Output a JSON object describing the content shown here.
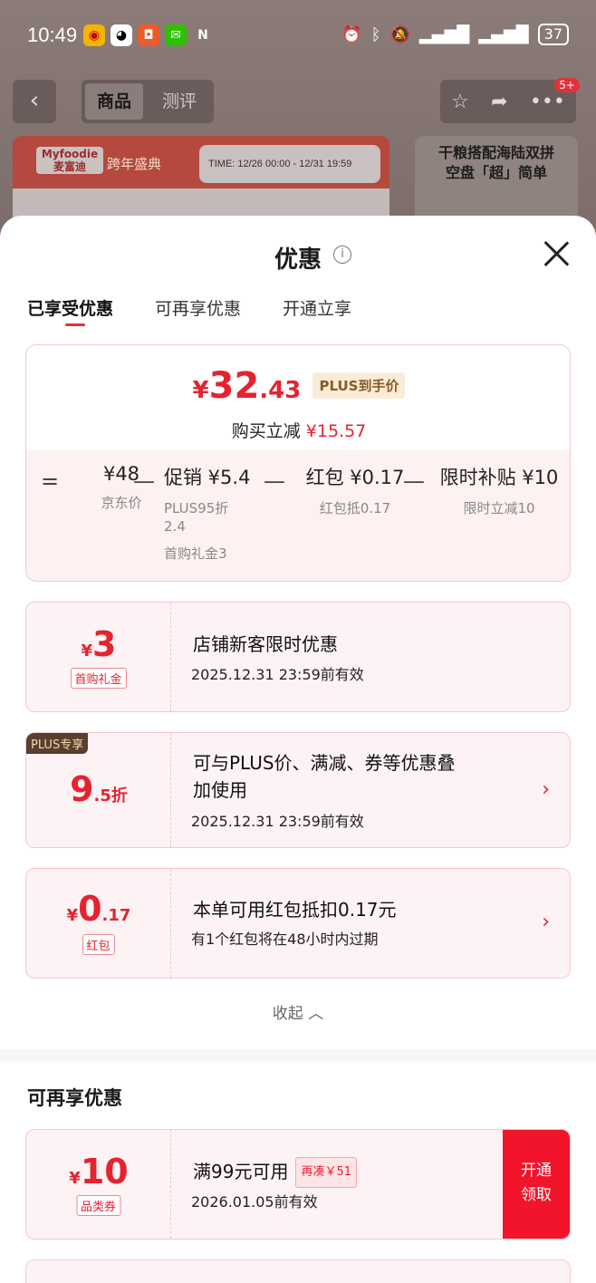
{
  "status_bar": {
    "time": "10:49",
    "battery": "37",
    "apps": [
      "weibo-icon",
      "qq-icon",
      "taobao-icon",
      "wechat-icon",
      "nfc-icon"
    ],
    "system": [
      "alarm-icon",
      "bluetooth-icon",
      "mute-icon",
      "signal-icon",
      "signal-icon"
    ]
  },
  "header": {
    "segment_active": "商品",
    "segment_inactive": "测评",
    "badge": "5+"
  },
  "background": {
    "brand": "Myfoodie\n麦富迪",
    "banner_label": "跨年盛典",
    "banner_time": "TIME: 12/26 00:00 - 12/31 19:59",
    "right_promo": "干粮搭配海陆双拼\n空盘「超」简单"
  },
  "sheet": {
    "title": "优惠",
    "tabs": [
      "已享受优惠",
      "可再享优惠",
      "开通立享"
    ],
    "summary": {
      "price_yen": "¥",
      "price_int": "32",
      "price_dec": ".43",
      "price_tag": "PLUS到手价",
      "save_label": "购买立减",
      "save_value": "¥15.57",
      "items": [
        {
          "op": "=",
          "value": "¥48",
          "sub": "京东价"
        },
        {
          "op": "—",
          "value": "促销 ¥5.4",
          "sub1": "PLUS95折",
          "sub2": "2.4",
          "sub3": "首购礼金3"
        },
        {
          "op": "—",
          "value": "红包 ¥0.17",
          "sub": "红包抵0.17"
        },
        {
          "op": "—",
          "value": "限时补贴 ¥10",
          "sub": "限时立减10"
        }
      ]
    },
    "coupons": [
      {
        "sym": "¥",
        "amount": "3",
        "tag": "首购礼金",
        "title": "店铺新客限时优惠",
        "sub": "2025.12.31  23:59前有效"
      },
      {
        "corner": "PLUS专享",
        "amount": "9",
        "decimal": ".5折",
        "title1": "可与PLUS价、满减、券等优惠叠",
        "title2": "加使用",
        "sub": "2025.12.31  23:59前有效"
      },
      {
        "sym": "¥",
        "amount": "0",
        "decimal": ".17",
        "tag": "红包",
        "title": "本单可用红包抵扣0.17元",
        "sub": "有1个红包将在48小时内过期"
      }
    ],
    "collapse_label": "收起",
    "more_section_title": "可再享优惠",
    "more_coupons": [
      {
        "sym": "¥",
        "amount": "10",
        "tag": "品类券",
        "title": "满99元可用",
        "need_tag": "再凑￥51",
        "sub": "2026.01.05前有效",
        "action1": "开通",
        "action2": "领取"
      }
    ]
  }
}
